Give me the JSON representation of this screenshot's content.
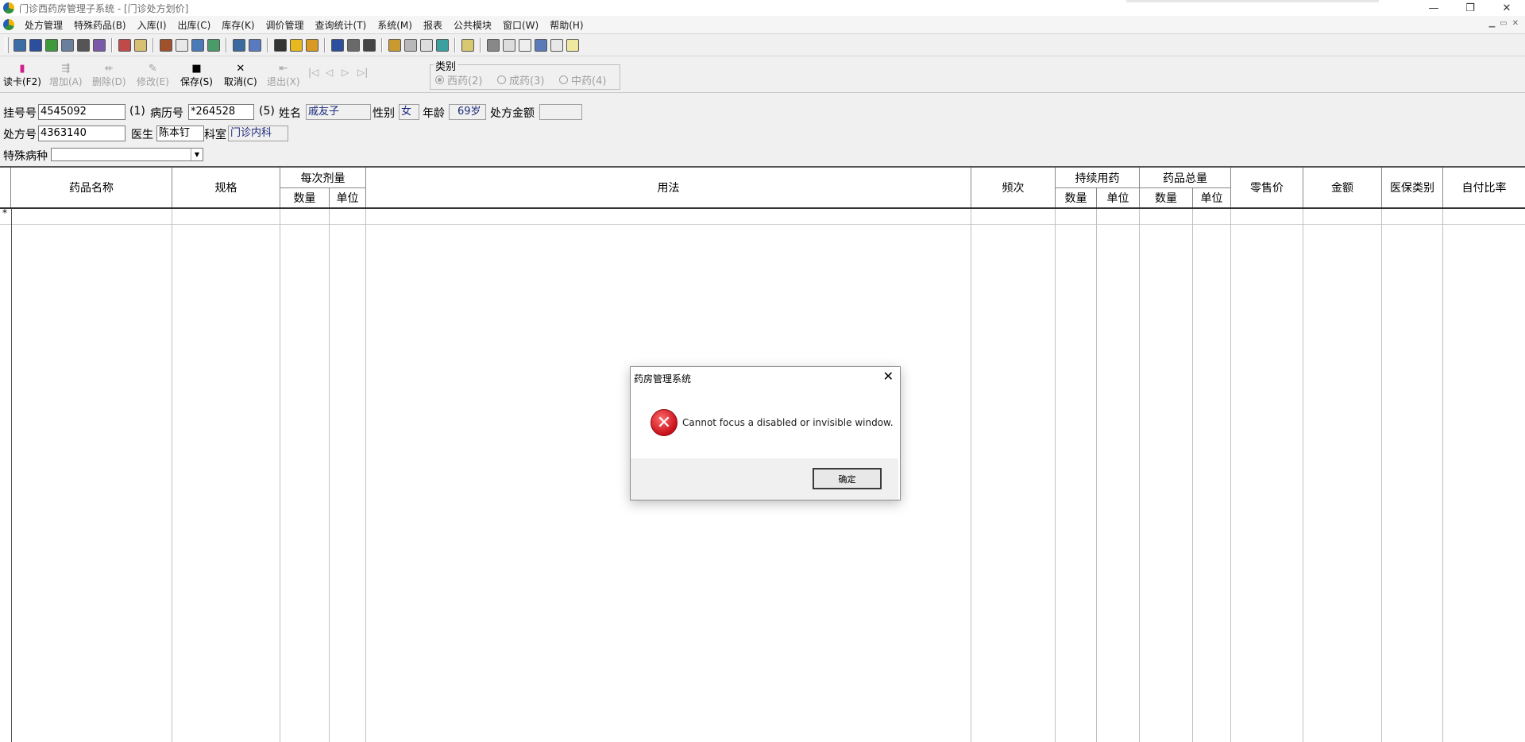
{
  "window": {
    "title": "门诊西药房管理子系统 - [门诊处方划价]",
    "minimize": "—",
    "restore": "❐",
    "close": "✕"
  },
  "menu": {
    "items": [
      "处方管理",
      "特殊药品(B)",
      "入库(I)",
      "出库(C)",
      "库存(K)",
      "调价管理",
      "查询统计(T)",
      "系统(M)",
      "报表",
      "公共模块",
      "窗口(W)",
      "帮助(H)"
    ]
  },
  "toolbar": {
    "read_card": "读卡(F2)",
    "add": "增加(A)",
    "delete": "删除(D)",
    "modify": "修改(E)",
    "save": "保存(S)",
    "cancel": "取消(C)",
    "exit": "退出(X)",
    "category_title": "类别",
    "category_options": [
      "西药(2)",
      "成药(3)",
      "中药(4)"
    ]
  },
  "form": {
    "reg_no_label": "挂号号",
    "reg_no_value": "4545092",
    "reg_no_hint": "(1)",
    "record_no_label": "病历号",
    "record_no_value": "*264528",
    "record_no_hint": "(5)",
    "name_label": "姓名",
    "name_value": "戚友子",
    "gender_label": "性别",
    "gender_value": "女",
    "age_label": "年龄",
    "age_value": "69岁",
    "amount_label": "处方金额",
    "amount_value": "",
    "rx_no_label": "处方号",
    "rx_no_value": "4363140",
    "doctor_label": "医生",
    "doctor_value": "陈本钉",
    "dept_label": "科室",
    "dept_value": "门诊内科",
    "special_label": "特殊病种",
    "special_value": ""
  },
  "grid": {
    "columns": {
      "drug_name": "药品名称",
      "spec": "规格",
      "dose_group": "每次剂量",
      "dose_qty": "数量",
      "dose_unit": "单位",
      "usage": "用法",
      "frequency": "频次",
      "cont_group": "持续用药",
      "cont_qty": "数量",
      "cont_unit": "单位",
      "total_group": "药品总量",
      "total_qty": "数量",
      "total_unit": "单位",
      "retail_price": "零售价",
      "amount": "金额",
      "insurance_type": "医保类别",
      "self_pay_ratio": "自付比率"
    },
    "new_row_marker": "*"
  },
  "dialog": {
    "title": "药房管理系统",
    "message": "Cannot focus a disabled or invisible window.",
    "ok_label": "确定",
    "close": "✕"
  }
}
